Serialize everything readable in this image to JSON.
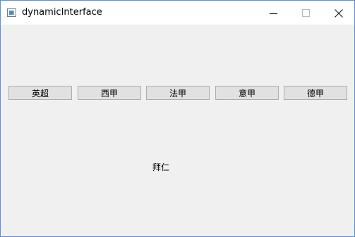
{
  "window": {
    "title": "dynamicInterface",
    "controls": {
      "minimize": "minimize-icon",
      "maximize": "maximize-icon",
      "close": "close-icon"
    }
  },
  "leagues": {
    "buttons": [
      {
        "label": "英超"
      },
      {
        "label": "西甲"
      },
      {
        "label": "法甲"
      },
      {
        "label": "意甲"
      },
      {
        "label": "德甲"
      }
    ]
  },
  "content": {
    "team_label": "拜仁"
  },
  "colors": {
    "window_border": "#5a8fd6",
    "titlebar_bg": "#ffffff",
    "client_bg": "#f0f0f0",
    "button_bg": "#e1e1e1",
    "button_border": "#adadad"
  }
}
